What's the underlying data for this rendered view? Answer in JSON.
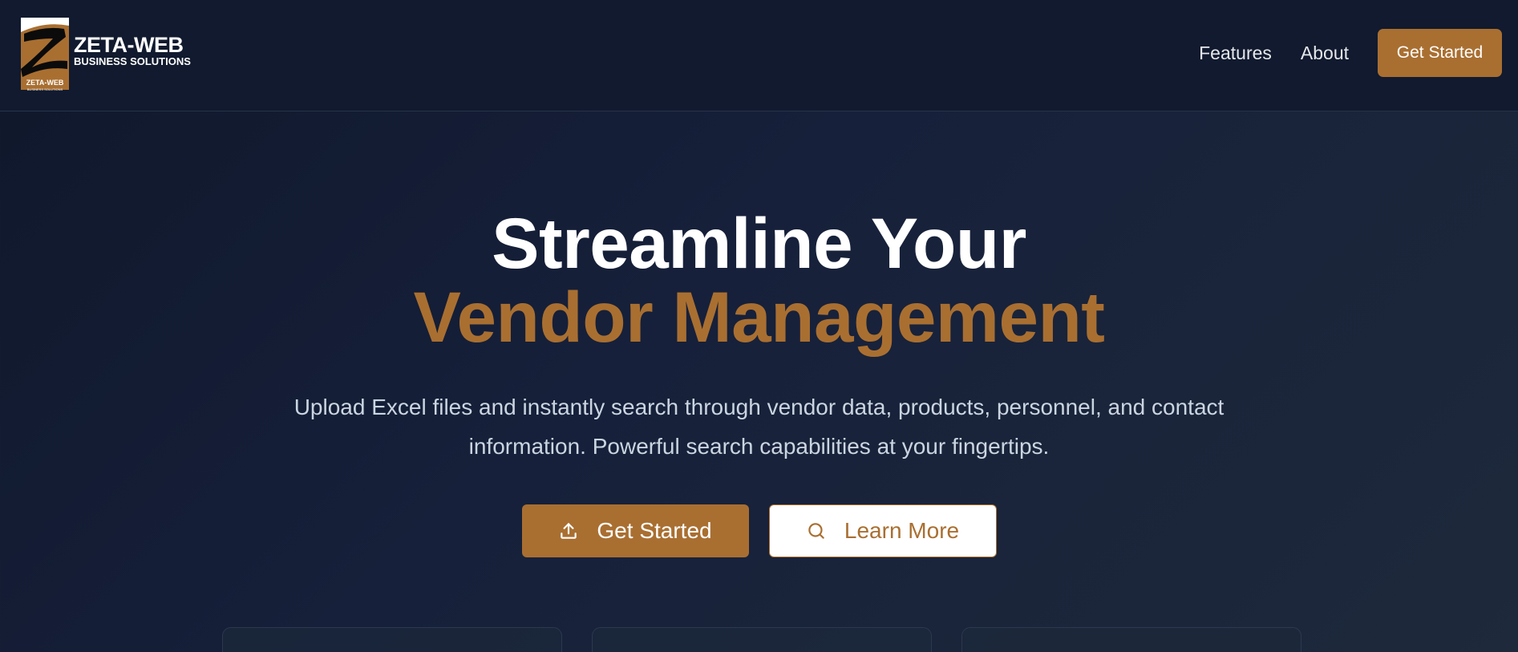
{
  "brand": {
    "name": "ZETA-WEB",
    "tagline": "BUSINESS SOLUTIONS",
    "mark_text": "ZETA-WEB",
    "mark_subtext": "BUSINESS SOLUTIONS",
    "colors": {
      "accent": "#a96f31",
      "background": "#0f172a",
      "header": "#111a2e"
    }
  },
  "nav": {
    "links": [
      "Features",
      "About"
    ],
    "cta_label": "Get Started"
  },
  "hero": {
    "title_line1": "Streamline Your",
    "title_line2": "Vendor Management",
    "description": "Upload Excel files and instantly search through vendor data, products, personnel, and contact information. Powerful search capabilities at your fingertips.",
    "primary_button": {
      "label": "Get Started",
      "icon": "upload-icon"
    },
    "secondary_button": {
      "label": "Learn More",
      "icon": "search-icon"
    }
  }
}
